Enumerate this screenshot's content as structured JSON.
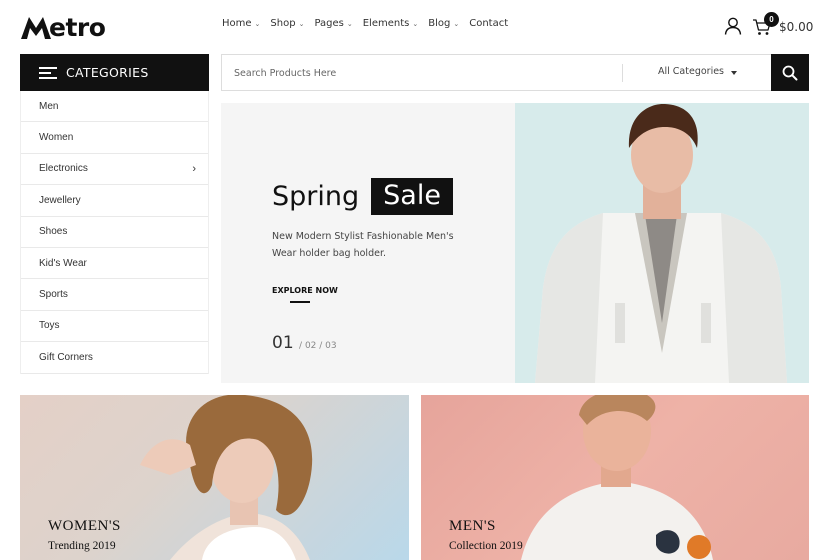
{
  "brand": {
    "name": "etro"
  },
  "nav": [
    {
      "label": "Home",
      "dropdown": true
    },
    {
      "label": "Shop",
      "dropdown": true
    },
    {
      "label": "Pages",
      "dropdown": true
    },
    {
      "label": "Elements",
      "dropdown": true
    },
    {
      "label": "Blog",
      "dropdown": true
    },
    {
      "label": "Contact",
      "dropdown": false
    }
  ],
  "cart": {
    "count": "0",
    "total": "$0.00"
  },
  "categories": {
    "title": "CATEGORIES",
    "items": [
      {
        "label": "Men",
        "submenu": false
      },
      {
        "label": "Women",
        "submenu": false
      },
      {
        "label": "Electronics",
        "submenu": true
      },
      {
        "label": "Jewellery",
        "submenu": false
      },
      {
        "label": "Shoes",
        "submenu": false
      },
      {
        "label": "Kid's Wear",
        "submenu": false
      },
      {
        "label": "Sports",
        "submenu": false
      },
      {
        "label": "Toys",
        "submenu": false
      },
      {
        "label": "Gift Corners",
        "submenu": false
      }
    ]
  },
  "search": {
    "placeholder": "Search Products Here",
    "category": "All Categories"
  },
  "hero": {
    "title_plain": "Spring",
    "title_highlight": "Sale",
    "subtitle": "New Modern Stylist Fashionable Men's Wear holder bag holder.",
    "cta": "EXPLORE NOW",
    "slide_current": "01",
    "slide_others": "/ 02 / 03",
    "bg_color": "#d7ebeb"
  },
  "banners": [
    {
      "title": "WOMEN'S",
      "subtitle": "Trending 2019"
    },
    {
      "title": "MEN'S",
      "subtitle": "Collection 2019"
    }
  ]
}
